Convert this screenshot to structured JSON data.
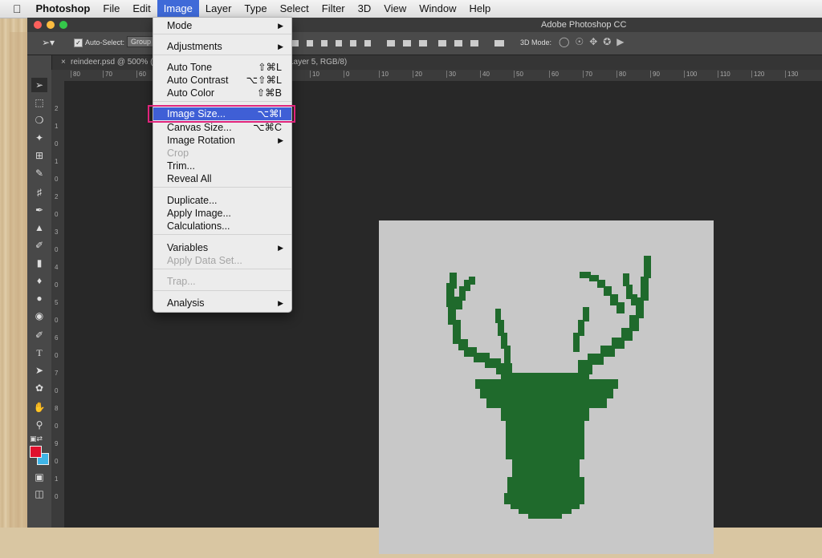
{
  "menubar": {
    "app_name": "Photoshop",
    "items": [
      "File",
      "Edit",
      "Image",
      "Layer",
      "Type",
      "Select",
      "Filter",
      "3D",
      "View",
      "Window",
      "Help"
    ],
    "active": "Image"
  },
  "window": {
    "title": "Adobe Photoshop CC",
    "doc_tab_left": "reindeer.psd @ 500% (L",
    "doc_tab_right": "Layer 5, RGB/8)"
  },
  "options_bar": {
    "auto_select_label": "Auto-Select:",
    "auto_select_value": "Group",
    "mode_3d_label": "3D Mode:"
  },
  "ruler_h": [
    "80",
    "70",
    "60",
    "10",
    "0",
    "10",
    "20",
    "30",
    "40",
    "50",
    "60",
    "70",
    "80",
    "90",
    "100",
    "110",
    "120",
    "130"
  ],
  "ruler_v": [
    "2",
    "1",
    "0",
    "1",
    "0",
    "2",
    "0",
    "3",
    "0",
    "4",
    "0",
    "5",
    "0",
    "6",
    "0",
    "7",
    "0",
    "8",
    "0",
    "9",
    "0",
    "1",
    "0"
  ],
  "image_menu": {
    "items": [
      {
        "label": "Mode",
        "submenu": true
      },
      {
        "sep": true
      },
      {
        "label": "Adjustments",
        "submenu": true
      },
      {
        "sep": true
      },
      {
        "label": "Auto Tone",
        "shortcut": "⇧⌘L"
      },
      {
        "label": "Auto Contrast",
        "shortcut": "⌥⇧⌘L"
      },
      {
        "label": "Auto Color",
        "shortcut": "⇧⌘B"
      },
      {
        "sep": true
      },
      {
        "label": "Image Size...",
        "shortcut": "⌥⌘I",
        "highlighted": true
      },
      {
        "label": "Canvas Size...",
        "shortcut": "⌥⌘C"
      },
      {
        "label": "Image Rotation",
        "submenu": true
      },
      {
        "label": "Crop",
        "disabled": true
      },
      {
        "label": "Trim..."
      },
      {
        "label": "Reveal All"
      },
      {
        "sep": true
      },
      {
        "label": "Duplicate..."
      },
      {
        "label": "Apply Image..."
      },
      {
        "label": "Calculations..."
      },
      {
        "sep": true
      },
      {
        "label": "Variables",
        "submenu": true
      },
      {
        "label": "Apply Data Set...",
        "disabled": true
      },
      {
        "sep": true
      },
      {
        "label": "Trap...",
        "disabled": true
      },
      {
        "sep": true
      },
      {
        "label": "Analysis",
        "submenu": true
      }
    ]
  },
  "colors": {
    "foreground": "#e0102d",
    "background": "#3fb5e8",
    "reindeer": "#1f6a2c",
    "canvas": "#c8c8c8",
    "highlight_box": "#e0247c",
    "menu_highlight": "#3f5fd6"
  }
}
